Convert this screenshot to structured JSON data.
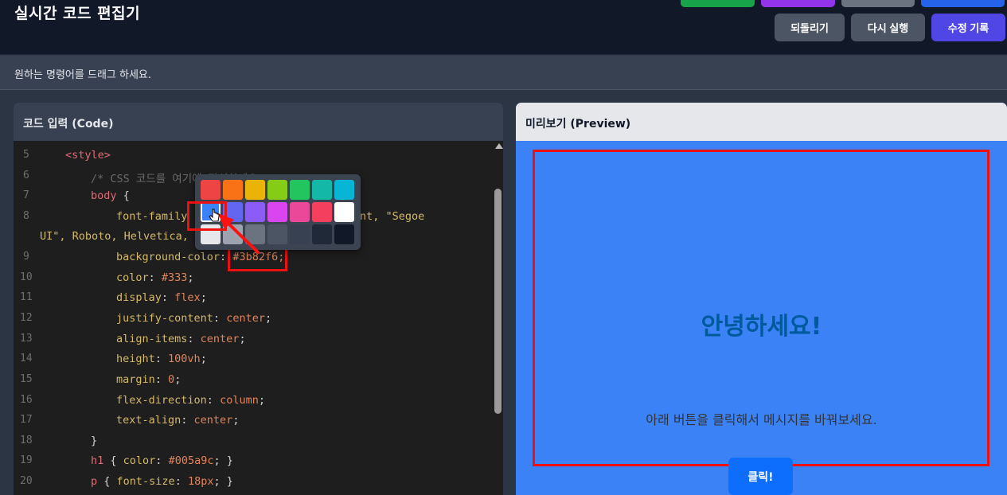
{
  "header": {
    "title": "실시간 코드 편집기",
    "buttons": {
      "undo": "되돌리기",
      "rerun": "다시 실행",
      "history": "수정 기록"
    }
  },
  "instruction": "원하는 명령어를 드래그 하세요.",
  "code_panel": {
    "title": "코드 입력 (Code)",
    "line_numbers": [
      "5",
      "6",
      "7",
      "8",
      "",
      "9",
      "10",
      "11",
      "12",
      "13",
      "14",
      "15",
      "16",
      "17",
      "18",
      "19",
      "20"
    ],
    "lines": {
      "l5": "<style>",
      "l6": "/* CSS 코드를 여기에 작성하세요 */",
      "l7_sel": "body",
      "l7_brace": " {",
      "l8_prop": "font-family",
      "l8_val": ": stemFont, \"Segoe",
      "l8b": "UI\", Roboto, Helvetica, A",
      "l9_prop": "background-color",
      "l9_val": "#3b82f6;",
      "l10_prop": "color",
      "l10_val": "#333",
      "l11_prop": "display",
      "l11_val": "flex",
      "l12_prop": "justify-content",
      "l12_val": "center",
      "l13_prop": "align-items",
      "l13_val": "center",
      "l14_prop": "height",
      "l14_val": "100vh",
      "l15_prop": "margin",
      "l15_val": "0",
      "l16_prop": "flex-direction",
      "l16_val": "column",
      "l17_prop": "text-align",
      "l17_val": "center",
      "l18": "}",
      "l19_sel": "h1",
      "l19_prop": "color",
      "l19_val": "#005a9c",
      "l20_sel": "p",
      "l20_prop": "font-size",
      "l20_val": "18px"
    }
  },
  "palette": {
    "colors": [
      "#ef4444",
      "#f97316",
      "#eab308",
      "#84cc16",
      "#22c55e",
      "#14b8a6",
      "#06b6d4",
      "#3b82f6",
      "#6366f1",
      "#8b5cf6",
      "#d946ef",
      "#ec4899",
      "#f43f5e",
      "#ffffff",
      "#e5e7eb",
      "#9ca3af",
      "#6b7280",
      "#4b5563",
      "#374151",
      "#1f2937",
      "#111827"
    ],
    "selected": "#3b82f6"
  },
  "preview": {
    "title": "미리보기 (Preview)",
    "heading": "안녕하세요!",
    "paragraph": "아래 버튼을 클릭해서 메시지를 바꿔보세요.",
    "button": "클릭!",
    "background": "#3b82f6"
  }
}
